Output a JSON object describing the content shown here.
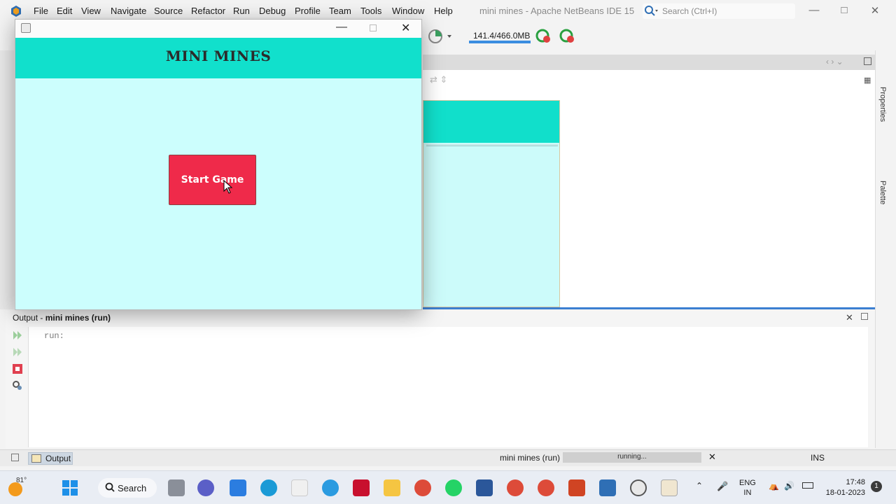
{
  "ide": {
    "menu": [
      "File",
      "Edit",
      "View",
      "Navigate",
      "Source",
      "Refactor",
      "Run",
      "Debug",
      "Profile",
      "Team",
      "Tools",
      "Window",
      "Help"
    ],
    "window_title": "mini mines - Apache NetBeans IDE 15",
    "search_placeholder": "Search (Ctrl+I)",
    "memory": "141.4/466.0MB",
    "memory_fraction": 0.303,
    "right_tabs": [
      "Properties",
      "Palette"
    ],
    "output": {
      "title_prefix": "Output - ",
      "title_bold": "mini mines (run)",
      "text": "run:"
    },
    "status": {
      "output_tab": "Output",
      "run_label": "mini mines (run)",
      "progress_text": "running...",
      "ins": "INS"
    }
  },
  "game": {
    "title": "MINI MINES",
    "start_button": "Start Game",
    "header_color": "#11e0cc",
    "background_color": "#ccfefd",
    "button_color": "#ef2a4a"
  },
  "taskbar": {
    "temperature": "81°",
    "search_label": "Search",
    "lang_line1": "ENG",
    "lang_line2": "IN",
    "time": "17:48",
    "date": "18-01-2023",
    "notifications": "1"
  }
}
